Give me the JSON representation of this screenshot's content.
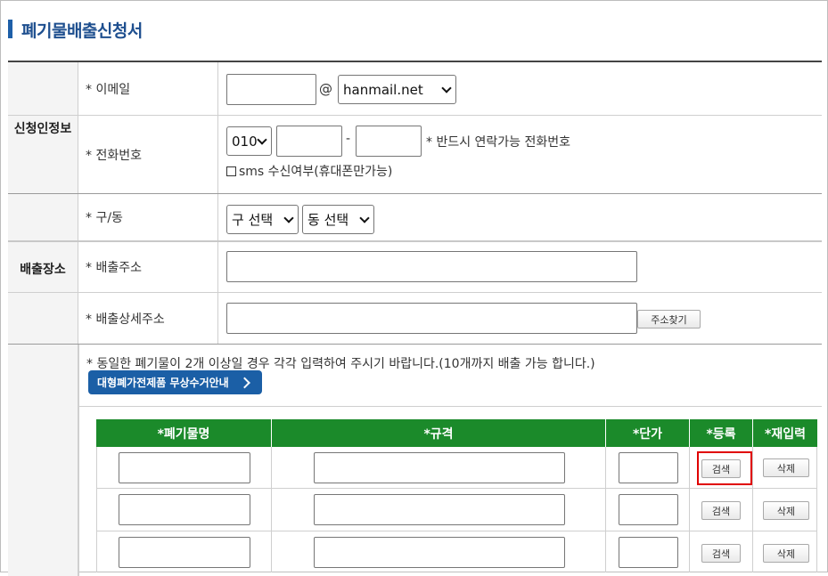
{
  "page": {
    "title": "폐기물배출신청서"
  },
  "applicant": {
    "section_label": "신청인정보",
    "email": {
      "label": "* 이메일",
      "local_value": "",
      "at_sign": "@",
      "domain_selected": "hanmail.net"
    },
    "phone": {
      "label": "* 전화번호",
      "prefix_selected": "010",
      "middle_value": "",
      "dash": "-",
      "last_value": "",
      "note": "* 반드시 연락가능 전화번호",
      "sms_checkbox_label": "sms 수신여부(휴대폰만가능)",
      "sms_checked": false
    }
  },
  "location": {
    "section_label": "배출장소",
    "district": {
      "label": "* 구/동",
      "gu_selected": "구 선택",
      "dong_selected": "동 선택"
    },
    "address": {
      "label": "* 배출주소",
      "value": ""
    },
    "detail_address": {
      "label": "* 배출상세주소",
      "value": "",
      "find_button": "주소찾기"
    }
  },
  "waste": {
    "notice": "* 동일한 폐기물이 2개 이상일 경우 각각 입력하여 주시기 바랍니다.(10개까지 배출 가능 합니다.)",
    "guide_button": "대형폐가전제품 무상수거안내",
    "columns": [
      "*폐기물명",
      "*규격",
      "*단가",
      "*등록",
      "*재입력"
    ],
    "rows": [
      {
        "name": "",
        "spec": "",
        "price": "",
        "search_label": "검색",
        "delete_label": "삭제"
      },
      {
        "name": "",
        "spec": "",
        "price": "",
        "search_label": "검색",
        "delete_label": "삭제"
      },
      {
        "name": "",
        "spec": "",
        "price": "",
        "search_label": "검색",
        "delete_label": "삭제"
      }
    ]
  },
  "colors": {
    "title": "#1e4f8f",
    "header_green": "#1b8a2a",
    "guide_blue": "#1b5fa6",
    "highlight_red": "#e00000"
  },
  "icons": [
    "chevron-down-icon",
    "chevron-right-icon",
    "checkbox-icon"
  ]
}
